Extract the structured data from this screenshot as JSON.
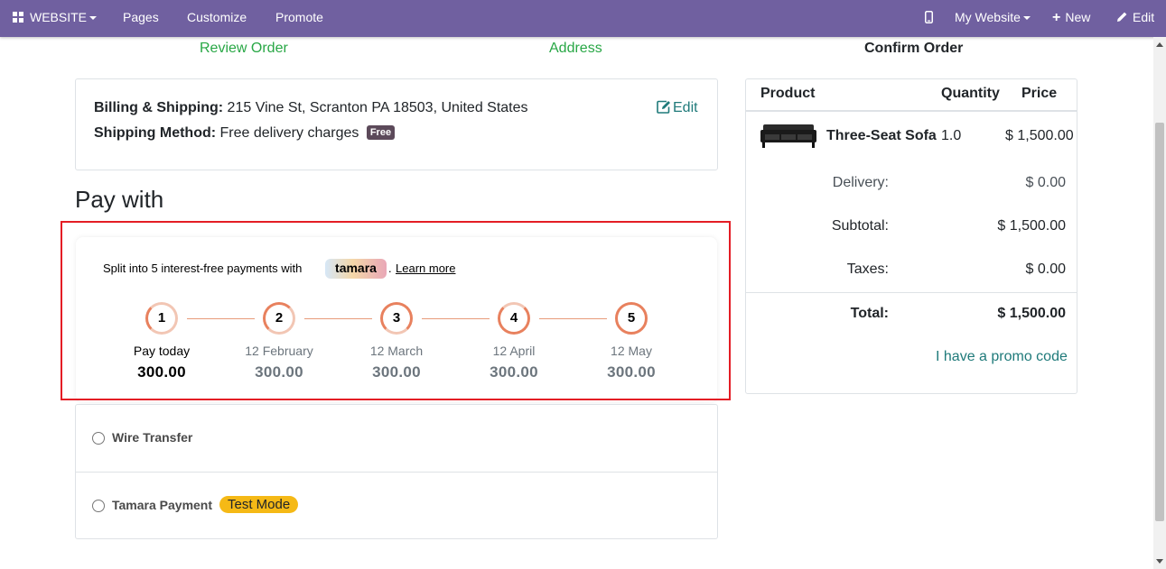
{
  "topbar": {
    "website_menu": "WEBSITE",
    "pages": "Pages",
    "customize": "Customize",
    "promote": "Promote",
    "my_website": "My Website",
    "new": "New",
    "edit": "Edit"
  },
  "steps": [
    "Review Order",
    "Address",
    "Confirm Order"
  ],
  "billing": {
    "billing_label": "Billing & Shipping:",
    "billing_value": "215 Vine St, Scranton PA 18503, United States",
    "shipping_label": "Shipping Method:",
    "shipping_value": "Free delivery charges",
    "free_badge": "Free",
    "edit_label": "Edit"
  },
  "pay_with_title": "Pay with",
  "tamara": {
    "split_text": "Split into 5 interest-free payments with",
    "logo_text": "tamara",
    "dot": ".",
    "learn_more": "Learn more",
    "installments": [
      {
        "number": "1",
        "label": "Pay today",
        "amount": "300.00"
      },
      {
        "number": "2",
        "label": "12 February",
        "amount": "300.00"
      },
      {
        "number": "3",
        "label": "12 March",
        "amount": "300.00"
      },
      {
        "number": "4",
        "label": "12 April",
        "amount": "300.00"
      },
      {
        "number": "5",
        "label": "12 May",
        "amount": "300.00"
      }
    ]
  },
  "payment_methods": [
    {
      "label": "Wire Transfer"
    },
    {
      "label": "Tamara Payment",
      "badge": "Test Mode"
    }
  ],
  "summary": {
    "headers": {
      "product": "Product",
      "quantity": "Quantity",
      "price": "Price"
    },
    "item": {
      "name": "Three-Seat Sofa",
      "quantity": "1.0",
      "price": "$ 1,500.00"
    },
    "delivery_label": "Delivery:",
    "delivery_value": "$ 0.00",
    "subtotal_label": "Subtotal:",
    "subtotal_value": "$ 1,500.00",
    "taxes_label": "Taxes:",
    "taxes_value": "$ 0.00",
    "total_label": "Total:",
    "total_value": "$ 1,500.00",
    "promo": "I have a promo code"
  },
  "colors": {
    "topbar": "#7060a0",
    "step_done": "#28a745",
    "link": "#1f7a7a",
    "highlight": "#e41d25",
    "test_badge": "#f5b916",
    "installment_line": "#e89a7a"
  }
}
